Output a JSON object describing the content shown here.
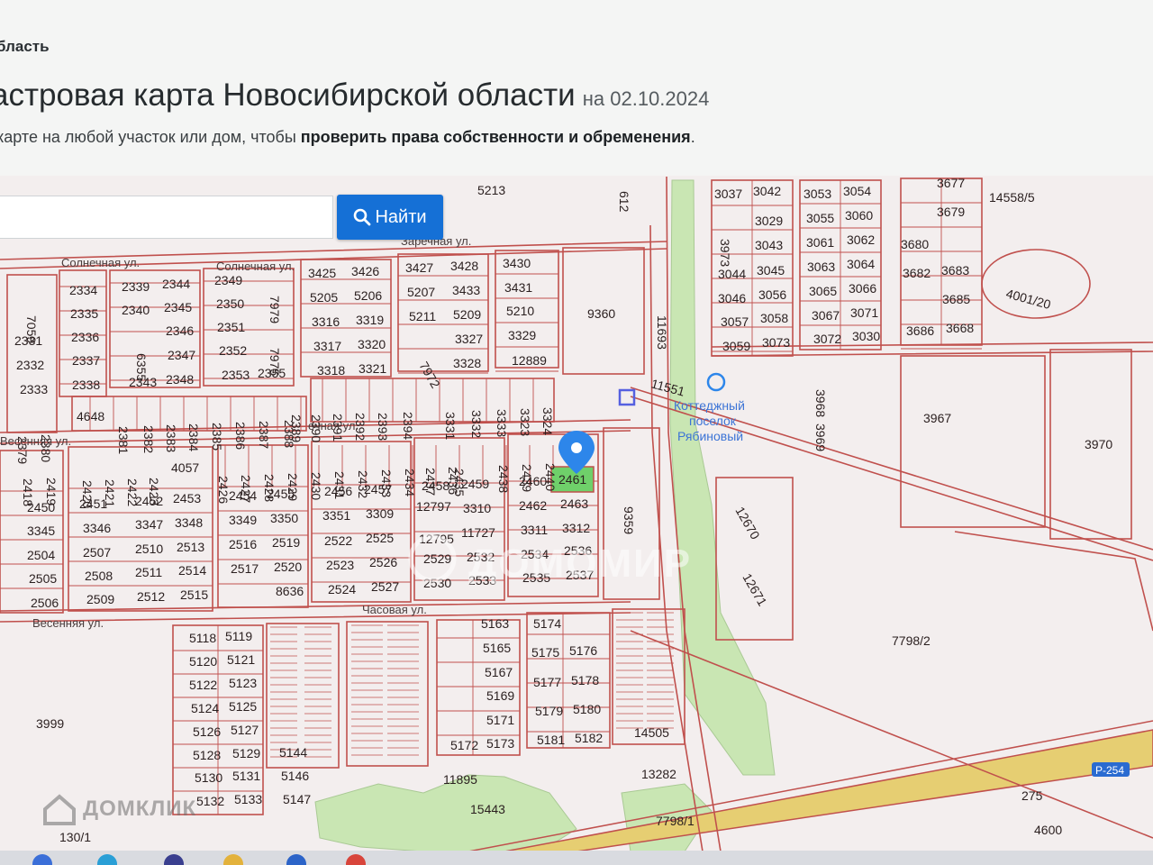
{
  "header": {
    "region": "бласть",
    "title": "астровая карта Новосибирской области",
    "date_prefix": "на",
    "date": "02.10.2024",
    "subtitle_plain": "карте на любой участок или дом, чтобы ",
    "subtitle_bold": "проверить права собственности и обременения",
    "subtitle_end": "."
  },
  "search": {
    "placeholder": "",
    "button_label": "Найти"
  },
  "colors": {
    "parcel_line": "#c0504d",
    "selected_parcel": "#6fd06a",
    "marker": "#2d86ea",
    "forest": "#c9e6b3",
    "road": "#e6ce72",
    "button": "#1570d6"
  },
  "map": {
    "selected_parcel": "2461",
    "marker_icon": "map-pin-icon",
    "streets": [
      {
        "label": "Солнечная ул."
      },
      {
        "label": "Солнечная ул."
      },
      {
        "label": "Заречная ул."
      },
      {
        "label": "ечная ул."
      },
      {
        "label": "Весенняя ул."
      },
      {
        "label": "Весенняя ул."
      },
      {
        "label": "Часовая ул."
      }
    ],
    "poi": {
      "lines": [
        "Коттеджный",
        "поселок",
        "Рябиновый"
      ]
    },
    "road_label": "Р-254",
    "parcels": [
      "5213",
      "612",
      "3037",
      "3042",
      "3053",
      "3054",
      "3677",
      "14558/5",
      "3973",
      "3029",
      "3055",
      "3060",
      "3679",
      "3043",
      "3061",
      "3062",
      "3680",
      "3044",
      "3045",
      "3063",
      "3064",
      "3682",
      "3683",
      "4001/20",
      "3046",
      "3056",
      "3065",
      "3066",
      "3685",
      "3057",
      "3058",
      "3067",
      "3071",
      "3059",
      "3073",
      "3072",
      "3030",
      "3686",
      "3668",
      "9360",
      "11693",
      "3427",
      "3428",
      "3430",
      "3425",
      "3426",
      "5207",
      "3433",
      "3431",
      "5205",
      "5206",
      "5211",
      "5209",
      "5210",
      "3316",
      "3319",
      "3327",
      "3329",
      "3317",
      "3320",
      "7972",
      "3328",
      "12889",
      "3318",
      "3321",
      "3331",
      "3332",
      "3333",
      "3323",
      "3324",
      "2393",
      "2394",
      "2390",
      "2391",
      "2392",
      "2389",
      "2349",
      "2350",
      "2351",
      "2352",
      "2353",
      "2355",
      "7979",
      "7975",
      "2339",
      "2344",
      "2340",
      "2345",
      "2346",
      "6355",
      "2347",
      "2343",
      "2348",
      "2334",
      "2335",
      "2336",
      "2337",
      "2338",
      "7059",
      "2331",
      "2332",
      "2333",
      "4648",
      "2381",
      "2382",
      "2383",
      "2384",
      "2385",
      "2386",
      "2387",
      "2388",
      "2379",
      "2380",
      "11551",
      "3968",
      "3969",
      "3967",
      "3970",
      "2436",
      "2437",
      "2435",
      "2438",
      "2439",
      "2440",
      "2461",
      "2434",
      "2433",
      "2432",
      "2431",
      "2430",
      "2429",
      "2428",
      "2427",
      "2426",
      "4057",
      "2423",
      "2422",
      "2421",
      "2420",
      "2419",
      "2418",
      "2460",
      "2458",
      "2459",
      "2462",
      "2463",
      "12797",
      "3310",
      "3311",
      "3312",
      "2456",
      "2457",
      "3351",
      "3309",
      "2454",
      "2455",
      "3349",
      "3350",
      "2452",
      "2453",
      "3347",
      "3348",
      "2451",
      "3346",
      "2450",
      "3345",
      "12795",
      "11727",
      "2534",
      "2536",
      "2522",
      "2525",
      "2516",
      "2519",
      "2510",
      "2513",
      "2507",
      "2504",
      "2529",
      "2532",
      "2535",
      "2537",
      "2523",
      "2526",
      "2517",
      "2520",
      "2511",
      "2514",
      "2508",
      "2505",
      "2530",
      "2533",
      "2524",
      "2527",
      "8636",
      "2512",
      "2515",
      "2509",
      "2506",
      "9359",
      "12670",
      "12671",
      "7798/2",
      "5118",
      "5119",
      "5120",
      "5121",
      "5122",
      "5123",
      "5124",
      "5125",
      "5126",
      "5127",
      "5128",
      "5129",
      "5130",
      "5131",
      "5132",
      "5133",
      "5144",
      "5146",
      "5147",
      "5163",
      "5165",
      "5167",
      "5169",
      "5171",
      "5172",
      "5173",
      "5174",
      "5175",
      "5176",
      "5177",
      "5178",
      "5179",
      "5180",
      "5181",
      "5182",
      "14505",
      "11895",
      "13282",
      "15443",
      "7798/1",
      "275",
      "4600",
      "3999",
      "130/1"
    ]
  },
  "watermark": {
    "center": "ДОМОМИР",
    "logo": "ДОМКЛИК"
  }
}
